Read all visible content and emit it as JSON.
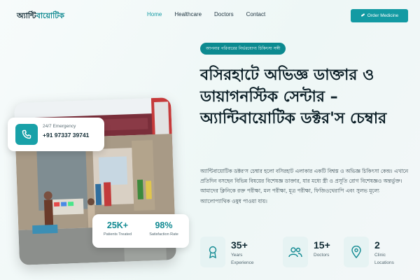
{
  "nav": {
    "logo_main": "অ্যান্টি",
    "logo_accent": "বায়োটিক",
    "links": [
      "Home",
      "Healthcare",
      "Doctors",
      "Contact"
    ],
    "active_link": "Home",
    "order_button": "Order Medicine"
  },
  "hero": {
    "tagline": "আপনার পরিবারের নির্ভরযোগ্য চিকিৎসা সঙ্গী",
    "headline": "বসিরহাটে অভিজ্ঞ ডাক্তার ও ডায়াগনস্টিক সেন্টার – অ্যান্টিবায়োটিক ডক্টর'স চেম্বার",
    "description": "অ্যান্টিবায়োটিক ডক্টর'স চেম্বার হলো বসিরহাট এলাকার একটি বিশ্বস্ত ও অভিজ্ঞ চিকিৎসা কেন্দ্র। এখানে প্রতিদিন বসছেন বিভিন্ন বিষয়ের বিশেষজ্ঞ ডাক্তার, যার মধ্যে স্ত্রী ও প্রসূতি রোগ বিশেষজ্ঞও অন্তর্ভুক্ত। আমাদের ক্লিনিকে রক্ত পরীক্ষা, মল পরীক্ষা, মূত্র পরীক্ষা, ফিজিওথেরাপি এবং সুলভ মূল্যে অ্যালোপ্যাথিক ওষুধ পাওয়া যায়।"
  },
  "stats": [
    {
      "value": "35+",
      "label_1": "Years",
      "label_2": "Experience",
      "icon": "award-icon"
    },
    {
      "value": "15+",
      "label_1": "Doctors",
      "label_2": "",
      "icon": "users-icon"
    },
    {
      "value": "2",
      "label_1": "Clinic",
      "label_2": "Locations",
      "icon": "map-pin-icon"
    }
  ],
  "emergency": {
    "label": "24/7 Emergency",
    "phone": "+91 97337 39741"
  },
  "counts": [
    {
      "value": "25K+",
      "label": "Patients Treated"
    },
    {
      "value": "98%",
      "label": "Satisfaction Rate"
    }
  ],
  "colors": {
    "accent": "#139aa3",
    "dark": "#0c1f27"
  }
}
